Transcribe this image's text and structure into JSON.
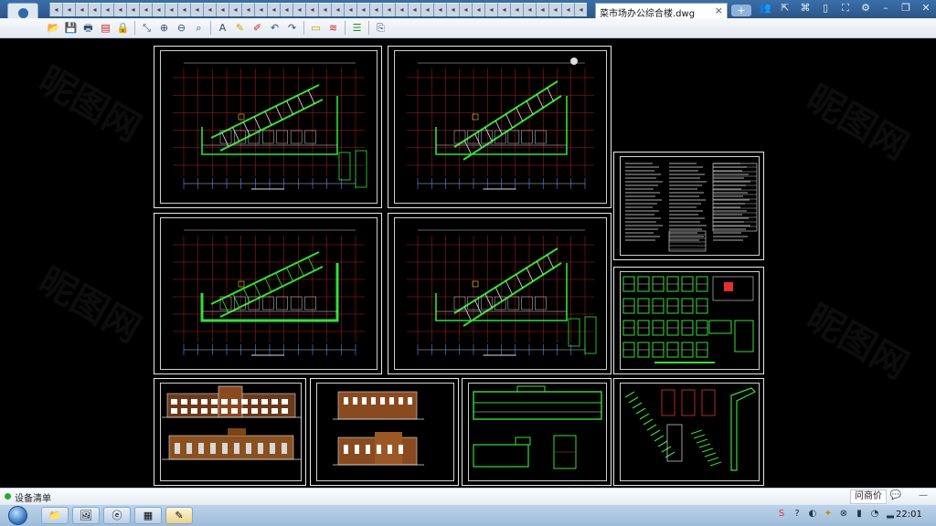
{
  "titlebar": {
    "active_tab_title": "菜市场办公综合楼.dwg",
    "tab_close": "×",
    "new_tab": "+",
    "avatar_icon": "user-avatar-icon",
    "mini_tab_count_label": "",
    "window_controls": [
      "people",
      "open",
      "share",
      "settings",
      "min",
      "restore",
      "close"
    ]
  },
  "toolbar": {
    "tools": [
      {
        "icon": "open-icon",
        "glyph": "📂",
        "cls": ""
      },
      {
        "icon": "save-icon",
        "glyph": "💾",
        "cls": ""
      },
      {
        "icon": "print-icon",
        "glyph": "🖶",
        "cls": ""
      },
      {
        "icon": "pdf-icon",
        "glyph": "▤",
        "cls": "red"
      },
      {
        "icon": "lock-icon",
        "glyph": "🔒",
        "cls": "yel"
      },
      {
        "sep": true
      },
      {
        "icon": "select-icon",
        "glyph": "⤡",
        "cls": ""
      },
      {
        "icon": "zoom-in-icon",
        "glyph": "⊕",
        "cls": ""
      },
      {
        "icon": "zoom-out-icon",
        "glyph": "⊖",
        "cls": ""
      },
      {
        "icon": "zoom-window-icon",
        "glyph": "⌕",
        "cls": ""
      },
      {
        "sep": true
      },
      {
        "icon": "text-icon",
        "glyph": "A",
        "cls": ""
      },
      {
        "icon": "pen-icon",
        "glyph": "✎",
        "cls": "yel"
      },
      {
        "icon": "markup-icon",
        "glyph": "✐",
        "cls": "red"
      },
      {
        "icon": "undo-icon",
        "glyph": "↶",
        "cls": ""
      },
      {
        "icon": "redo-icon",
        "glyph": "↷",
        "cls": ""
      },
      {
        "sep": true
      },
      {
        "icon": "measure-icon",
        "glyph": "▭",
        "cls": "yel"
      },
      {
        "icon": "scale-icon",
        "glyph": "≋",
        "cls": "red"
      },
      {
        "sep": true
      },
      {
        "icon": "layers-icon",
        "glyph": "☰",
        "cls": "grn"
      },
      {
        "sep": true
      },
      {
        "icon": "export-icon",
        "glyph": "⎘",
        "cls": ""
      }
    ]
  },
  "statusbar": {
    "text": "设备清单",
    "qa_button": "问商价",
    "chat_icon": "chat-icon",
    "min_icon": "minimize-icon"
  },
  "taskbar": {
    "clock": "22:01",
    "tasks": [
      "folder",
      "browser",
      "ie",
      "winrar",
      "cad"
    ]
  },
  "watermark": "昵图网"
}
